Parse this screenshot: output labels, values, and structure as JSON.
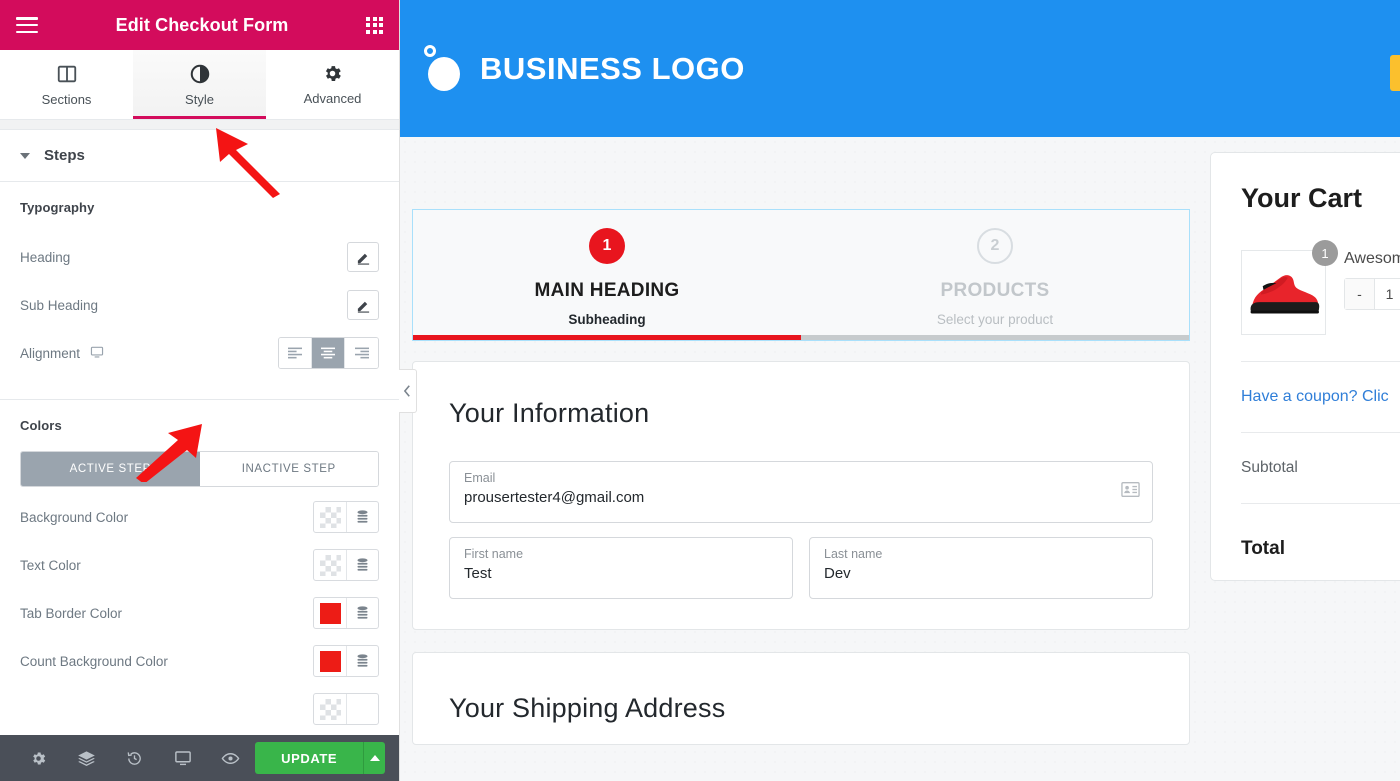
{
  "panel": {
    "header": {
      "title": "Edit Checkout Form",
      "menu_icon": "hamburger-icon",
      "apps_icon": "grid-apps-icon"
    },
    "tabs": [
      {
        "label": "Sections",
        "icon": "columns-icon",
        "active": false
      },
      {
        "label": "Style",
        "icon": "contrast-half-circle-icon",
        "active": true
      },
      {
        "label": "Advanced",
        "icon": "gear-icon",
        "active": false
      }
    ],
    "section": {
      "title": "Steps",
      "expanded": true
    },
    "typography": {
      "group_title": "Typography",
      "rows": [
        {
          "label": "Heading",
          "control": "pencil-edit-icon"
        },
        {
          "label": "Sub Heading",
          "control": "pencil-edit-icon"
        }
      ],
      "alignment": {
        "label": "Alignment",
        "device_icon": "desktop-icon",
        "options": [
          "align-left",
          "align-center",
          "align-right"
        ],
        "selected": "align-center"
      }
    },
    "colors": {
      "group_title": "Colors",
      "tabs": [
        {
          "label": "ACTIVE STEP",
          "active": true
        },
        {
          "label": "INACTIVE STEP",
          "active": false
        }
      ],
      "rows": [
        {
          "label": "Background Color",
          "swatch": "transparent",
          "value": "",
          "db_icon": "database-icon"
        },
        {
          "label": "Text Color",
          "swatch": "transparent",
          "value": "",
          "db_icon": "database-icon"
        },
        {
          "label": "Tab Border Color",
          "swatch": "solid",
          "value": "#ed1c16",
          "db_icon": "database-icon"
        },
        {
          "label": "Count Background Color",
          "swatch": "solid",
          "value": "#ed1c16",
          "db_icon": "database-icon"
        }
      ]
    },
    "footer": {
      "icons": [
        "gear-icon",
        "layers-icon",
        "history-revisions-icon",
        "responsive-desktop-icon",
        "preview-eye-icon"
      ],
      "update_label": "UPDATE",
      "update_caret": "caret-up-icon",
      "update_color": "#39b54a"
    },
    "collapse_handle": "chevron-left-icon",
    "accent": "#d30c5c"
  },
  "canvas": {
    "site_header": {
      "logo_text": "BUSINESS LOGO",
      "logo_icon": "two-dots-logo-icon",
      "bg": "#1e90f0",
      "corner_tab": "yellow-side-tab"
    },
    "steps": [
      {
        "number": "1",
        "title": "MAIN HEADING",
        "subtitle": "Subheading",
        "active": true
      },
      {
        "number": "2",
        "title": "PRODUCTS",
        "subtitle": "Select your product",
        "active": false
      }
    ],
    "progress_percent": 50,
    "progress_color": "#e8151e",
    "information_card": {
      "title": "Your Information",
      "email": {
        "label": "Email",
        "value": "prousertester4@gmail.com",
        "icon": "contact-card-autofill-icon"
      },
      "first_name": {
        "label": "First name",
        "value": "Test"
      },
      "last_name": {
        "label": "Last name",
        "value": "Dev"
      }
    },
    "shipping_card": {
      "title": "Your Shipping Address"
    },
    "cart": {
      "title": "Your Cart",
      "item": {
        "name": "Awesome",
        "badge": "1",
        "thumb": "red-sneaker-image"
      },
      "stepper": {
        "minus": "-",
        "qty": "1",
        "plus": "+"
      },
      "coupon_link": "Have a coupon? Clic",
      "subtotal_label": "Subtotal",
      "total_label": "Total"
    }
  }
}
